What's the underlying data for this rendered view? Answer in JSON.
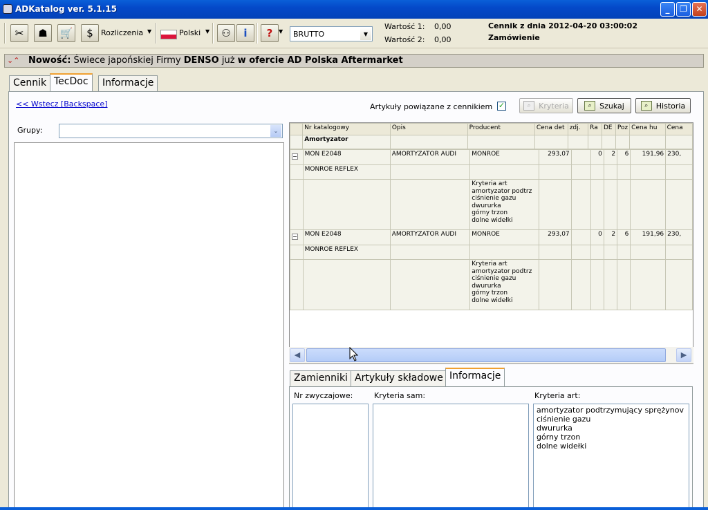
{
  "window": {
    "title": "ADKatalog   ver. 5.1.15"
  },
  "toolbar": {
    "rozliczenia_label": "Rozliczenia",
    "language_label": "Polski",
    "price_mode": "BRUTTO",
    "wartosc1_label": "Wartość 1:",
    "wartosc1_value": "0,00",
    "wartosc2_label": "Wartość 2:",
    "wartosc2_value": "0,00",
    "cennik_info": "Cennik z dnia 2012-04-20 03:00:02",
    "zamowienie": "Zamówienie"
  },
  "news": {
    "prefix": "Nowość:",
    "text_normal": " Świece japońskiej Firmy ",
    "brand": "DENSO",
    "text_mid": " już ",
    "text_bold": "w ofercie AD Polska Aftermarket"
  },
  "main_tabs": [
    "Cennik",
    "TecDoc",
    "Informacje"
  ],
  "back_link": "<< Wstecz [Backspace]",
  "groups_label": "Grupy:",
  "groups_value": "",
  "linked_label": "Artykuły powiązane z cennikiem",
  "buttons": {
    "kryteria": "Kryteria",
    "szukaj": "Szukaj",
    "historia": "Historia"
  },
  "grid": {
    "columns": [
      "Nr katalogowy",
      "Opis",
      "Producent",
      "Cena det",
      "zdj.",
      "Ra",
      "DE",
      "Poz",
      "Cena hu",
      "Cena"
    ],
    "group_title": "Amortyzator",
    "items": [
      {
        "nr": "MON E2048",
        "opis": "AMORTYZATOR AUDI",
        "producent": "MONROE",
        "cena_det": "293,07",
        "ra": "0",
        "de": "2",
        "poz": "6",
        "cena_hu": "191,96",
        "cena": "230,",
        "subtitle": "MONROE REFLEX",
        "criteria": [
          "Kryteria art",
          "amortyzator podtrz",
          "ciśnienie gazu",
          "dwururka",
          "górny trzon",
          "dolne widełki"
        ]
      },
      {
        "nr": "MON E2048",
        "opis": "AMORTYZATOR AUDI",
        "producent": "MONROE",
        "cena_det": "293,07",
        "ra": "0",
        "de": "2",
        "poz": "6",
        "cena_hu": "191,96",
        "cena": "230,",
        "subtitle": "MONROE REFLEX",
        "criteria": [
          "Kryteria art",
          "amortyzator podtrz",
          "ciśnienie gazu",
          "dwururka",
          "górny trzon",
          "dolne widełki"
        ]
      }
    ]
  },
  "bottom_tabs": [
    "Zamienniki",
    "Artykuły składowe",
    "Informacje"
  ],
  "bottom": {
    "nr_label": "Nr zwyczajowe:",
    "kryteria_sam_label": "Kryteria sam:",
    "kryteria_art_label": "Kryteria art:",
    "kryteria_art_lines": [
      "amortyzator podtrzymujący sprężynov",
      "ciśnienie gazu",
      "dwururka",
      "górny trzon",
      "dolne widełki"
    ]
  }
}
